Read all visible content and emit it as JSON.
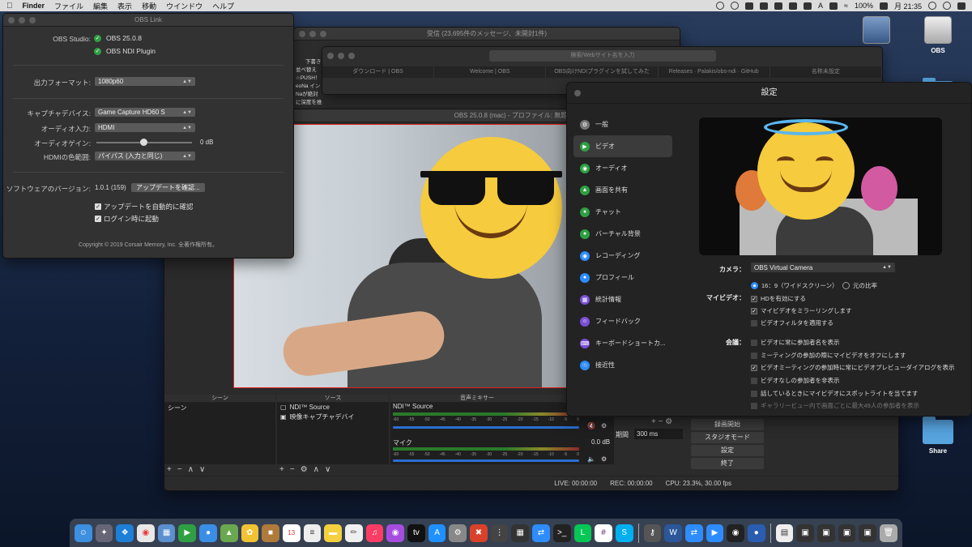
{
  "menubar": {
    "app": "Finder",
    "items": [
      "ファイル",
      "編集",
      "表示",
      "移動",
      "ウインドウ",
      "ヘルプ"
    ],
    "battery": "100%",
    "time": "月 21:35"
  },
  "desktop": {
    "icons": [
      "OBS",
      "Share"
    ]
  },
  "obs_link": {
    "title": "OBS Link",
    "studio_label": "OBS Studio:",
    "studio_version": "OBS 25.0.8",
    "ndi_plugin": "OBS NDI Plugin",
    "output_format_label": "出力フォーマット:",
    "output_format": "1080p60",
    "capture_device_label": "キャプチャデバイス:",
    "capture_device": "Game Capture HD60 S",
    "audio_input_label": "オーディオ入力:",
    "audio_input": "HDMI",
    "audio_gain_label": "オーディオゲイン:",
    "audio_gain": "0 dB",
    "hdmi_range_label": "HDMIの色範囲:",
    "hdmi_range": "パイパス (入力と同じ)",
    "software_version_label": "ソフトウェアのバージョン:",
    "software_version": "1.0.1 (159)",
    "update_button": "アップデートを確認...",
    "auto_update": "アップデートを自動的に確認",
    "launch_at_login": "ログイン時に起動",
    "copyright": "Copyright © 2019 Corsair Memory, Inc. 全著作権所有。"
  },
  "mail": {
    "title": "受信 (23,695件のメッセージ、未開封1件)",
    "snippets": [
      "下書き",
      "並べ替え",
      "☆PUSH！",
      "eoNa イン",
      "Naが絶対",
      "に深度を推"
    ]
  },
  "safari": {
    "url_placeholder": "検索/Webサイト名を入力",
    "tabs": [
      "ダウンロード | OBS",
      "Welcome | OBS",
      "OBS向けNDIプラグインを試してみた",
      "Releases · Palakis/obs-ndi · GitHub",
      "名称未設定"
    ]
  },
  "obs": {
    "title": "OBS 25.0.8 (mac) - プロファイル: 無題 - シーン: 無題",
    "panels": {
      "scenes": "シーン",
      "sources": "ソース",
      "mixer": "音声ミキサー"
    },
    "scene_items": [
      "シーン"
    ],
    "source_items": [
      "NDI™ Source",
      "映像キャプチャデバイ"
    ],
    "mixer": [
      {
        "name": "NDI™ Source",
        "db": ""
      },
      {
        "name": "マイク",
        "db": "0.0 dB"
      }
    ],
    "ticks": [
      "-60",
      "-55",
      "-50",
      "-45",
      "-40",
      "-35",
      "-30",
      "-25",
      "-20",
      "-15",
      "-10",
      "-5",
      "0"
    ],
    "duration_label": "期間",
    "duration": "300 ms",
    "buttons": [
      "録画開始",
      "スタジオモード",
      "設定",
      "終了"
    ],
    "status": {
      "live": "LIVE: 00:00:00",
      "rec": "REC: 00:00:00",
      "cpu": "CPU: 23.3%, 30.00 fps"
    }
  },
  "zoom": {
    "title": "設定",
    "sidebar": [
      "一般",
      "ビデオ",
      "オーディオ",
      "画面を共有",
      "チャット",
      "バーチャル背景",
      "レコーディング",
      "プロフィール",
      "統計情報",
      "フィードバック",
      "キーボードショートカ...",
      "接近性"
    ],
    "selected": "ビデオ",
    "camera_label": "カメラ：",
    "camera": "OBS Virtual Camera",
    "my_video_label": "マイビデオ：",
    "ratio_169": "16：9（ワイドスクリーン）",
    "ratio_orig": "元の比率",
    "hd": "HDを有効にする",
    "mirror": "マイビデオをミラーリングします",
    "filter": "ビデオフィルタを適用する",
    "meeting_label": "会議：",
    "meeting_opts": [
      "ビデオに常に参加者名を表示",
      "ミーティングの参加の際にマイビデオをオフにします",
      "ビデオミーティングの参加時に常にビデオプレビューダイアログを表示",
      "ビデオなしの参加者を非表示",
      "話しているときにマイビデオにスポットライトを当てます",
      "ギャラリービュー内で画面ごとに最大49人の参加者を表示"
    ]
  }
}
